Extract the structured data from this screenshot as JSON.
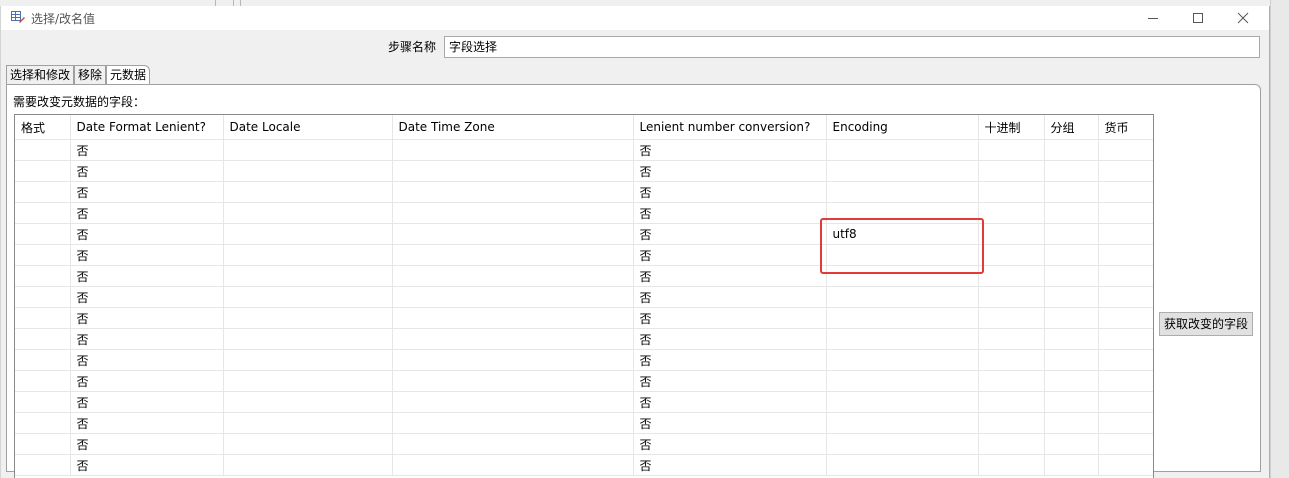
{
  "window": {
    "title": "选择/改名值",
    "icon": "table-edit-icon",
    "controls": [
      "minimize-icon",
      "maximize-icon",
      "close-icon"
    ]
  },
  "step_name": {
    "label": "步骤名称",
    "value": "字段选择"
  },
  "tabs": [
    {
      "label": "选择和修改",
      "active": false
    },
    {
      "label": "移除",
      "active": false
    },
    {
      "label": "元数据",
      "active": true
    }
  ],
  "meta_panel": {
    "label": "需要改变元数据的字段："
  },
  "table": {
    "columns": [
      "格式",
      "Date Format Lenient?",
      "Date Locale",
      "Date Time Zone",
      "Lenient number conversion?",
      "Encoding",
      "十进制",
      "分组",
      "货币"
    ],
    "rows": [
      [
        "",
        "否",
        "",
        "",
        "否",
        "",
        "",
        "",
        ""
      ],
      [
        "",
        "否",
        "",
        "",
        "否",
        "",
        "",
        "",
        ""
      ],
      [
        "",
        "否",
        "",
        "",
        "否",
        "",
        "",
        "",
        ""
      ],
      [
        "",
        "否",
        "",
        "",
        "否",
        "",
        "",
        "",
        ""
      ],
      [
        "",
        "否",
        "",
        "",
        "否",
        "utf8",
        "",
        "",
        ""
      ],
      [
        "",
        "否",
        "",
        "",
        "否",
        "",
        "",
        "",
        ""
      ],
      [
        "",
        "否",
        "",
        "",
        "否",
        "",
        "",
        "",
        ""
      ],
      [
        "",
        "否",
        "",
        "",
        "否",
        "",
        "",
        "",
        ""
      ],
      [
        "",
        "否",
        "",
        "",
        "否",
        "",
        "",
        "",
        ""
      ],
      [
        "",
        "否",
        "",
        "",
        "否",
        "",
        "",
        "",
        ""
      ],
      [
        "",
        "否",
        "",
        "",
        "否",
        "",
        "",
        "",
        ""
      ],
      [
        "",
        "否",
        "",
        "",
        "否",
        "",
        "",
        "",
        ""
      ],
      [
        "",
        "否",
        "",
        "",
        "否",
        "",
        "",
        "",
        ""
      ],
      [
        "",
        "否",
        "",
        "",
        "否",
        "",
        "",
        "",
        ""
      ],
      [
        "",
        "否",
        "",
        "",
        "否",
        "",
        "",
        "",
        ""
      ],
      [
        "",
        "否",
        "",
        "",
        "否",
        "",
        "",
        "",
        ""
      ]
    ]
  },
  "buttons": {
    "get_fields": "获取改变的字段"
  },
  "colors": {
    "highlight": "#e23a3a",
    "window_bg": "#f0f0f0",
    "grid_line": "#e6e6e6"
  }
}
